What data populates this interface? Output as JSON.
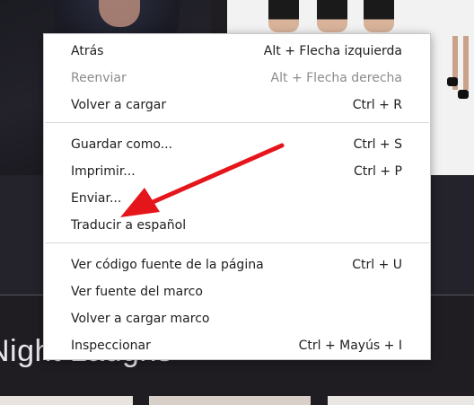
{
  "background": {
    "heading_text": "Night Laughs"
  },
  "context_menu": {
    "items": [
      {
        "label": "Atrás",
        "shortcut": "Alt + Flecha izquierda",
        "enabled": true
      },
      {
        "label": "Reenviar",
        "shortcut": "Alt + Flecha derecha",
        "enabled": false
      },
      {
        "label": "Volver a cargar",
        "shortcut": "Ctrl + R",
        "enabled": true
      },
      {
        "label": "Guardar como...",
        "shortcut": "Ctrl + S",
        "enabled": true
      },
      {
        "label": "Imprimir...",
        "shortcut": "Ctrl + P",
        "enabled": true
      },
      {
        "label": "Enviar...",
        "shortcut": "",
        "enabled": true
      },
      {
        "label": "Traducir a español",
        "shortcut": "",
        "enabled": true
      },
      {
        "label": "Ver código fuente de la página",
        "shortcut": "Ctrl + U",
        "enabled": true
      },
      {
        "label": "Ver fuente del marco",
        "shortcut": "",
        "enabled": true
      },
      {
        "label": "Volver a cargar marco",
        "shortcut": "",
        "enabled": true
      },
      {
        "label": "Inspeccionar",
        "shortcut": "Ctrl + Mayús + I",
        "enabled": true
      }
    ]
  },
  "annotation": {
    "arrow_color": "#e5161b",
    "target_item": "Traducir a español"
  }
}
